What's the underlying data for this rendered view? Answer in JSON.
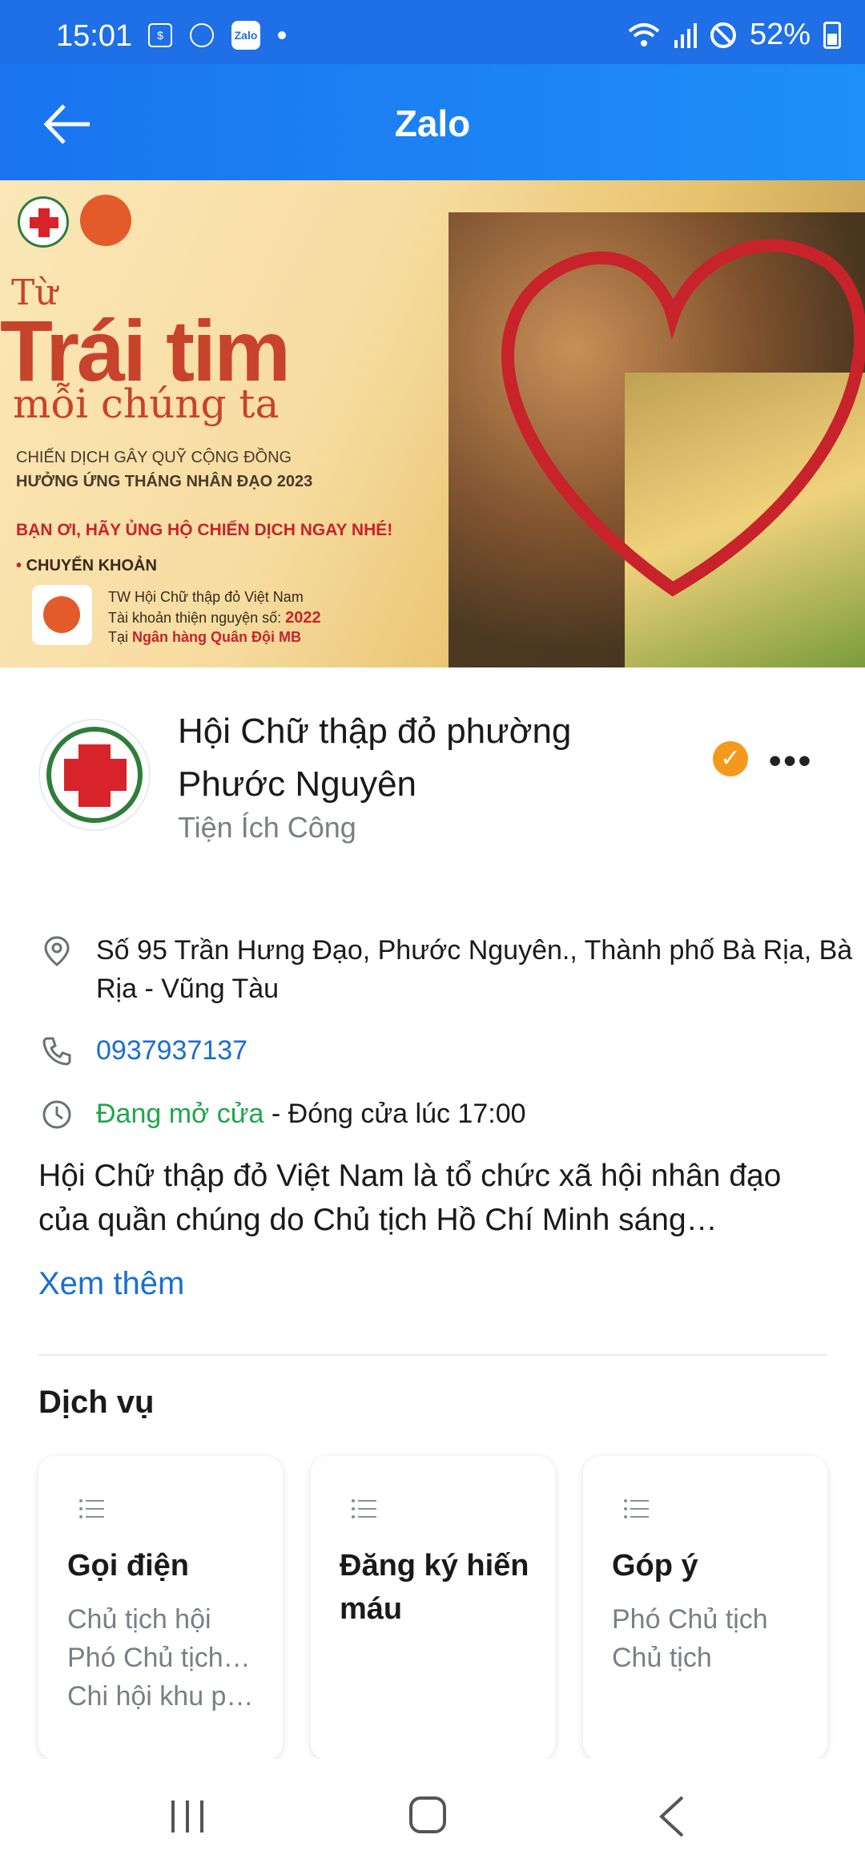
{
  "status_bar": {
    "time": "15:01",
    "zalo_icon_text": "Zalo",
    "battery": "52%"
  },
  "header": {
    "title": "Zalo"
  },
  "banner": {
    "line_tu": "Từ",
    "line_traitim": "Trái tim",
    "line_moi": "mỗi chúng ta",
    "line_campaign": "CHIẾN DỊCH GÂY QUỸ CỘNG ĐỒNG",
    "line_month": "HƯỞNG ỨNG THÁNG NHÂN ĐẠO 2023",
    "line_call": "BẠN ƠI, HÃY ỦNG HỘ CHIẾN DỊCH NGAY NHÉ!",
    "line_transfer": "CHUYỂN KHOẢN",
    "line_org": "TW Hội Chữ thập đỏ Việt Nam",
    "line_account_prefix": "Tài khoản thiện nguyện số:",
    "line_account_number": "2022",
    "line_bank_prefix": "Tại",
    "line_bank": "Ngân hàng Quân Đội MB"
  },
  "profile": {
    "name": "Hội Chữ thập đỏ phường Phước Nguyên",
    "category": "Tiện Ích Công",
    "more_label": "•••"
  },
  "info": {
    "address": "Số 95 Trần Hưng Đạo, Phước Nguyên., Thành phố Bà Rịa, Bà Rịa - Vũng Tàu",
    "phone": "0937937137",
    "open_status": "Đang mở cửa",
    "closing": " - Đóng cửa lúc 17:00"
  },
  "description": "Hội Chữ thập đỏ Việt Nam là tổ chức xã hội nhân đạo của quần chúng do Chủ tịch Hồ Chí Minh sáng…",
  "see_more": "Xem thêm",
  "services": {
    "title": "Dịch vụ",
    "cards": [
      {
        "title": "Gọi điện",
        "items": [
          "Chủ tịch hội",
          "Phó Chủ tịch…",
          "Chi hội khu p…"
        ]
      },
      {
        "title": "Đăng ký hiến máu",
        "items": []
      },
      {
        "title": "Góp ý",
        "items": [
          "Phó Chủ tịch",
          "Chủ tịch"
        ]
      }
    ]
  },
  "colors": {
    "header_blue": "#1f6fe6",
    "link_blue": "#1a6fd1",
    "open_green": "#20a64a",
    "verified_orange": "#f39a1c",
    "red_cross": "#d8232a"
  }
}
